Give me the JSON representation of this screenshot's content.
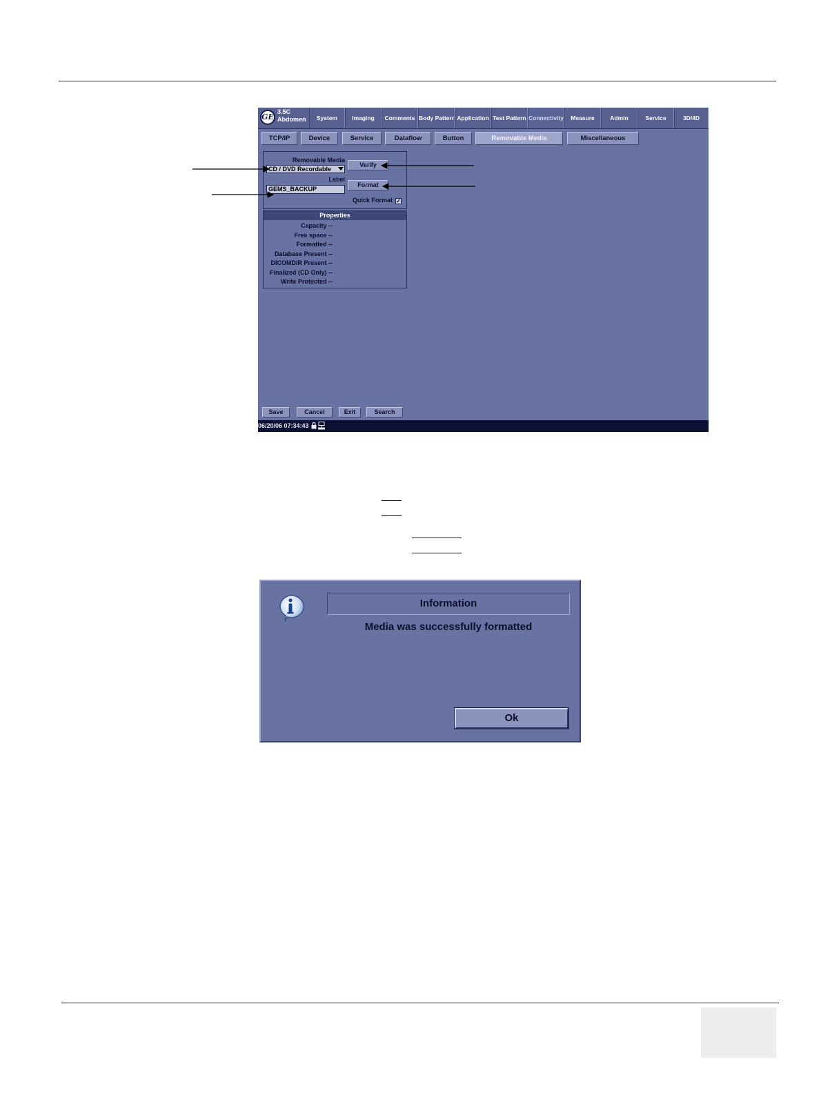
{
  "ui": {
    "probe_line1": "3.5C",
    "probe_line2": "Abdomen",
    "top_tabs": [
      "System",
      "Imaging",
      "Comments",
      "Body Pattern",
      "Application",
      "Test Pattern",
      "Connectivity",
      "Measure",
      "Admin",
      "Service",
      "3D/4D"
    ],
    "active_top_tab": "Connectivity",
    "sub_tabs": [
      "TCP/IP",
      "Device",
      "Service",
      "Dataflow",
      "Button",
      "Removable Media",
      "Miscellaneous"
    ],
    "active_sub_tab": "Removable Media",
    "removable_media_label": "Removable Media",
    "media_select_value": "CD / DVD Recordable",
    "verify_button": "Verify",
    "label_caption": "Label",
    "label_value": "GEMS_BACKUP",
    "format_button": "Format",
    "quick_format_label": "Quick Format",
    "quick_format_checked": true,
    "properties_header": "Properties",
    "properties": [
      "Capacity --",
      "Free space --",
      "Formatted --",
      "Database Present --",
      "DICOMDIR Present --",
      "Finalized (CD Only) --",
      "Write Protected --"
    ],
    "bottom_buttons": [
      "Save",
      "Cancel",
      "Exit",
      "Search"
    ],
    "status_datetime": "06/20/06 07:34:43"
  },
  "dialog": {
    "title": "Information",
    "message": "Media was successfully formatted",
    "ok_button": "Ok"
  },
  "icons": {
    "logo": "ge-logo-icon",
    "lock": "lock-icon",
    "network": "network-icon",
    "info": "info-icon"
  },
  "colors": {
    "ui_background": "#6873a3",
    "status_bar": "#0b1030",
    "button_face": "#8b93bd"
  }
}
